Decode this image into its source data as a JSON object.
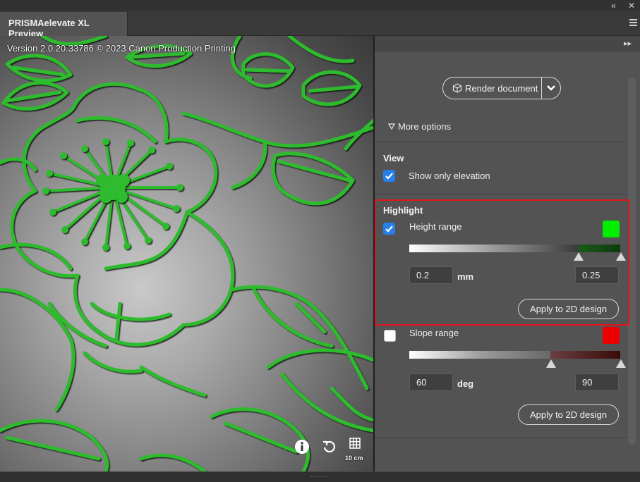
{
  "window": {
    "collapse_icon": "double-chevron-left-icon",
    "close_icon": "close-icon",
    "collapse_glyph": "«",
    "close_glyph": "✕"
  },
  "tab": {
    "title": "PRISMAelevate XL Preview"
  },
  "viewer": {
    "version_text": "Version 2.0.20.33786 © 2023 Canon Production Printing",
    "tools": {
      "info_icon": "info-icon",
      "reset_icon": "reset-rotate-icon",
      "grid_icon": "grid-icon",
      "grid_scale_label": "10 cm"
    },
    "art_color": "#2dbb2d"
  },
  "panel": {
    "render": {
      "label": "Render document",
      "icon": "cube-icon",
      "dropdown_icon": "chevron-down-icon"
    },
    "more_options": {
      "label": "More options",
      "icon": "triangle-down-icon"
    },
    "view": {
      "title": "View",
      "show_only_elevation": {
        "label": "Show only elevation",
        "checked": true
      }
    },
    "highlight": {
      "title": "Highlight",
      "height_range": {
        "label": "Height range",
        "checked": true,
        "color": "#00ee00",
        "min_value": "0.2",
        "max_value": "0.25",
        "unit": "mm",
        "apply_label": "Apply to 2D design"
      },
      "slope_range": {
        "label": "Slope range",
        "checked": false,
        "color": "#ee0000",
        "min_value": "60",
        "max_value": "90",
        "unit": "deg",
        "apply_label": "Apply to 2D design"
      }
    }
  }
}
